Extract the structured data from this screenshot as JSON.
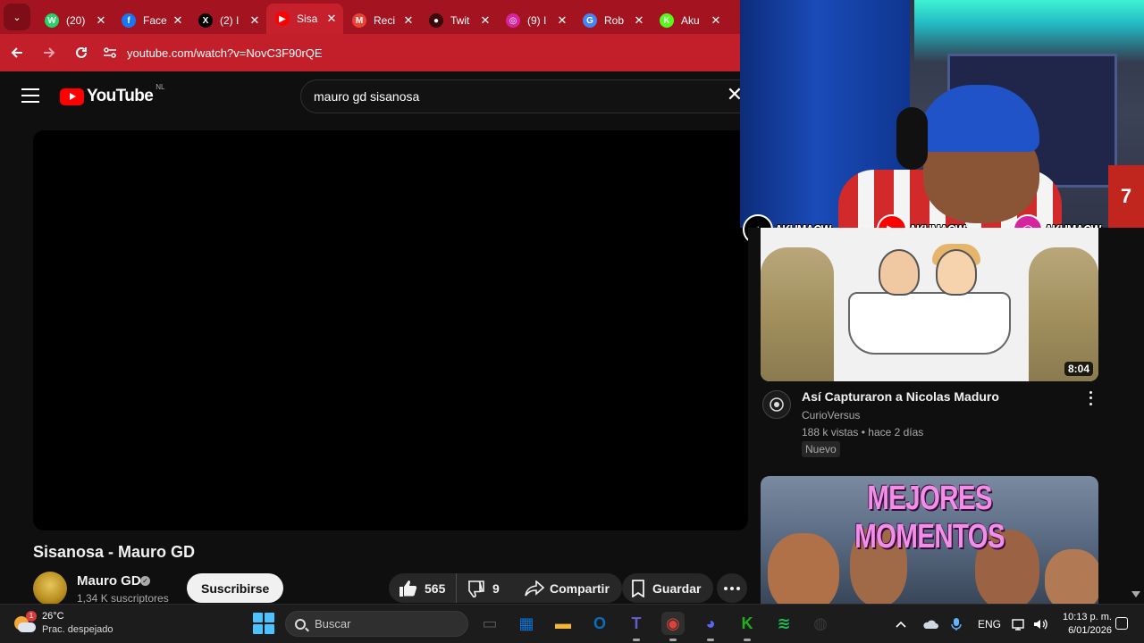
{
  "browser": {
    "tabs": [
      {
        "label": "(20)",
        "icon": "whatsapp-icon",
        "color": "#25d366",
        "glyph": "W"
      },
      {
        "label": "Face",
        "icon": "facebook-icon",
        "color": "#1877f2",
        "glyph": "f"
      },
      {
        "label": "(2) I",
        "icon": "x-icon",
        "color": "#000000",
        "glyph": "X"
      },
      {
        "label": "Sisa",
        "icon": "youtube-icon",
        "color": "#ff0000",
        "glyph": "▶"
      },
      {
        "label": "Reci",
        "icon": "gmail-icon",
        "color": "#ea4335",
        "glyph": "M"
      },
      {
        "label": "Twit",
        "icon": "twitch-icon",
        "color": "#3a0a0a",
        "glyph": "●"
      },
      {
        "label": "(9) I",
        "icon": "instagram-icon",
        "color": "#d6249f",
        "glyph": "◎"
      },
      {
        "label": "Rob",
        "icon": "google-icon",
        "color": "#4285f4",
        "glyph": "G"
      },
      {
        "label": "Aku",
        "icon": "kick-icon",
        "color": "#53fc18",
        "glyph": "K"
      }
    ],
    "close_glyph": "✕",
    "tab_menu_glyph": "⌄",
    "url": "youtube.com/watch?v=NovC3F90rQE"
  },
  "youtube": {
    "logo_text": "YouTube",
    "region": "NL",
    "search_value": "mauro gd sisanosa",
    "clear_glyph": "✕",
    "player_ghost_text": "",
    "video_title": "Sisanosa - Mauro GD",
    "channel_name": "Mauro GD",
    "verified_glyph": "✓",
    "subscribers": "1,34 K suscriptores",
    "subscribe_label": "Suscribirse",
    "likes": "565",
    "dislikes": "9",
    "share_label": "Compartir",
    "save_label": "Guardar"
  },
  "webcam": {
    "jersey_number": "7",
    "socials": [
      {
        "platform": "tiktok-icon",
        "glyph": "♪",
        "color": "#000000",
        "handle": "AKUMACW"
      },
      {
        "platform": "youtube-icon",
        "glyph": "▶",
        "color": "#ff0000",
        "handle": "AKUMACW"
      },
      {
        "platform": "instagram-icon",
        "glyph": "◎",
        "color": "#d6249f",
        "handle": "AKUMACW"
      }
    ]
  },
  "recommendations": [
    {
      "title": "Así Capturaron a Nicolas Maduro",
      "channel": "CurioVersus",
      "views": "188 k vistas",
      "age": "hace 2 días",
      "badge": "Nuevo",
      "duration": "8:04"
    },
    {
      "thumb_text": "MEJORES MOMENTOS"
    }
  ],
  "taskbar": {
    "weather_badge": "1",
    "temperature": "26°C",
    "condition": "Prac. despejado",
    "search_placeholder": "Buscar",
    "language": "ENG",
    "time": "10:13 p. m.",
    "date": "6/01/2026",
    "apps": [
      {
        "name": "task-view-icon",
        "color": "#5a5a5a",
        "glyph": "▭"
      },
      {
        "name": "store-icon",
        "color": "#0a74d8",
        "glyph": "▦"
      },
      {
        "name": "file-explorer-icon",
        "color": "#f3b83a",
        "glyph": "▬"
      },
      {
        "name": "outlook-icon",
        "color": "#0f6cbd",
        "glyph": "O"
      },
      {
        "name": "teams-icon",
        "color": "#5b5fc7",
        "glyph": "T"
      },
      {
        "name": "chrome-icon",
        "color": "#db4437",
        "glyph": "◉"
      },
      {
        "name": "discord-icon",
        "color": "#5865f2",
        "glyph": "◕"
      },
      {
        "name": "kick-app-icon",
        "color": "#1eb019",
        "glyph": "K"
      },
      {
        "name": "spotify-icon",
        "color": "#1db954",
        "glyph": "≋"
      },
      {
        "name": "obs-icon",
        "color": "#3a3a3a",
        "glyph": "◍"
      }
    ]
  },
  "colors": {
    "browser_accent": "#c21f2b",
    "youtube_red": "#ff0000",
    "background": "#0f0f0f"
  }
}
